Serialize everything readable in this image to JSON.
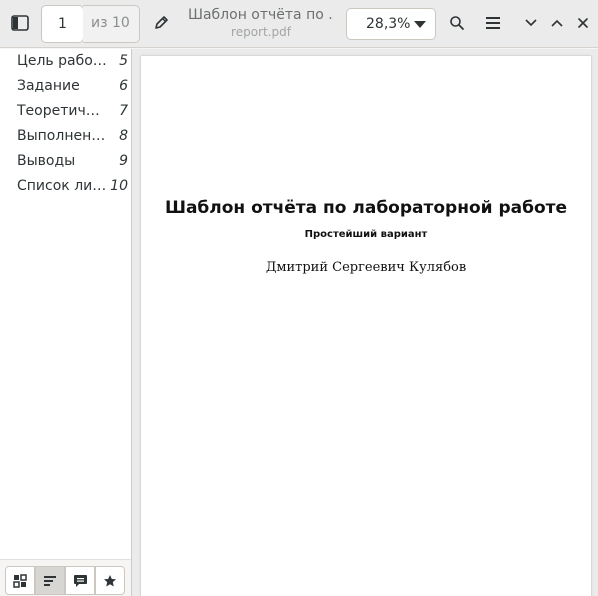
{
  "header": {
    "page_number": "1",
    "page_of": "из 10",
    "title": "Шаблон отчёта по ...",
    "subtitle": "report.pdf",
    "zoom": "28,3%"
  },
  "icons": {
    "sidebar_toggle": "sidebar-icon",
    "annotate": "pencil-icon",
    "search": "search-icon",
    "menu": "hamburger-icon",
    "next": "chevron-down-icon",
    "prev": "chevron-up-icon",
    "close": "close-icon"
  },
  "sidebar": {
    "outline": [
      {
        "label": "Цель работы",
        "page": "5"
      },
      {
        "label": "Задание",
        "page": "6"
      },
      {
        "label": "Теоретичес...",
        "page": "7"
      },
      {
        "label": "Выполнени...",
        "page": "8"
      },
      {
        "label": "Выводы",
        "page": "9"
      },
      {
        "label": "Список лите...",
        "page": "10"
      }
    ],
    "footer_buttons": [
      "thumbnails-icon",
      "outline-icon",
      "annotations-icon",
      "bookmarks-icon"
    ]
  },
  "document": {
    "heading": "Шаблон отчёта по лабораторной работе",
    "subheading": "Простейший вариант",
    "author": "Дмитрий Сергеевич Кулябов"
  },
  "colors": {
    "header_bg": "#ebebeb",
    "page_bg": "#ffffff",
    "text": "#2e3436"
  }
}
